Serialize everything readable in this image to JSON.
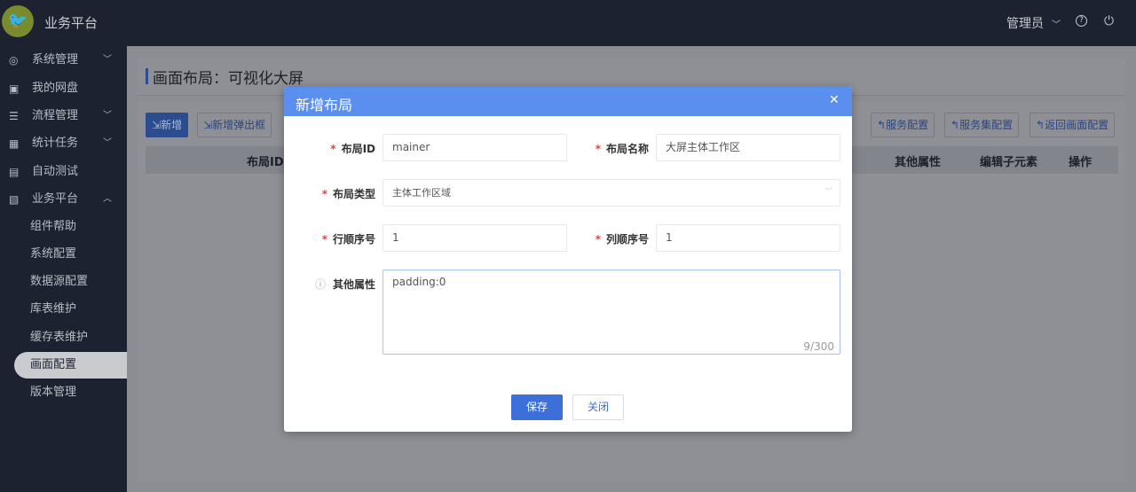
{
  "header": {
    "app_name": "业务平台",
    "user": "管理员",
    "user_chevron_icon": "chevron-down-icon",
    "help_icon": "question-circle-icon",
    "power_icon": "power-icon"
  },
  "sidebar": {
    "items": [
      {
        "label": "系统管理",
        "icon": "gear-icon",
        "expandable": true
      },
      {
        "label": "我的网盘",
        "icon": "disk-icon",
        "expandable": false
      },
      {
        "label": "流程管理",
        "icon": "flow-icon",
        "expandable": true
      },
      {
        "label": "统计任务",
        "icon": "stats-icon",
        "expandable": true
      },
      {
        "label": "自动测试",
        "icon": "test-icon",
        "expandable": false
      },
      {
        "label": "业务平台",
        "icon": "platform-icon",
        "expandable": true,
        "expanded": true
      }
    ],
    "sub_items": [
      "组件帮助",
      "系统配置",
      "数据源配置",
      "库表维护",
      "缓存表维护",
      "画面配置",
      "版本管理"
    ],
    "active": "画面配置"
  },
  "page": {
    "title": "画面布局：可视化大屏",
    "toolbar": {
      "add": "新增",
      "add_popup": "新增弹出框",
      "service_config": "服务配置",
      "service_set_config": "服务集配置",
      "back": "返回画面配置"
    },
    "table_headers": {
      "layout_id": "布局ID",
      "other": "其他属性",
      "edit_children": "编辑子元素",
      "ops": "操作"
    }
  },
  "modal": {
    "title": "新增布局",
    "fields": {
      "layout_id": {
        "label": "布局ID",
        "value": "mainer"
      },
      "layout_name": {
        "label": "布局名称",
        "value": "大屏主体工作区"
      },
      "layout_type": {
        "label": "布局类型",
        "value": "主体工作区域"
      },
      "row_order": {
        "label": "行顺序号",
        "value": "1"
      },
      "col_order": {
        "label": "列顺序号",
        "value": "1"
      },
      "other": {
        "label": "其他属性",
        "value": "padding:0",
        "count": "9/300"
      }
    },
    "save": "保存",
    "close": "关闭"
  },
  "colors": {
    "modal_header": "#5a8ff0",
    "primary": "#3d6fd8",
    "sidebar": "#1c2230"
  }
}
